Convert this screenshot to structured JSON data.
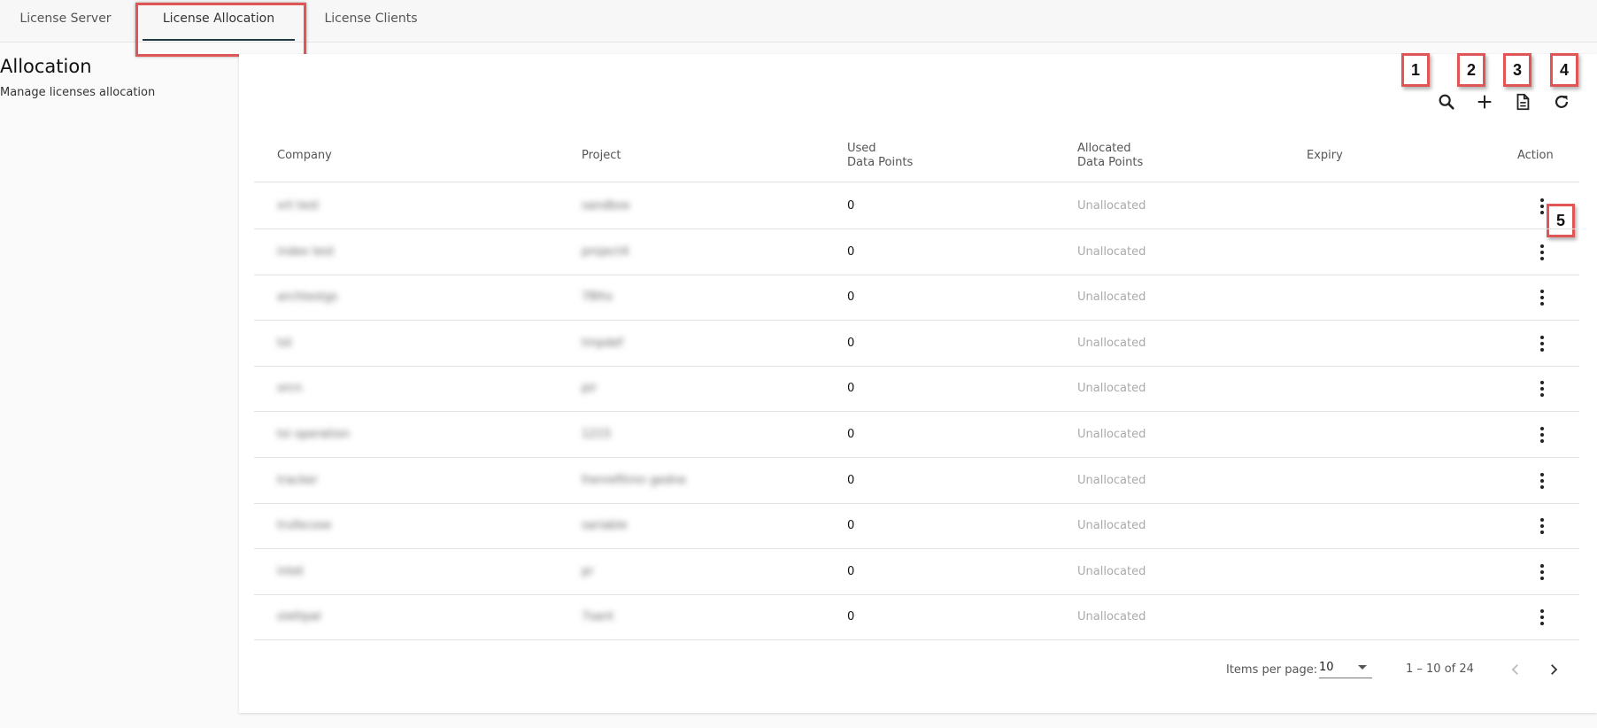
{
  "tabs": [
    {
      "label": "License Server",
      "active": false
    },
    {
      "label": "License Allocation",
      "active": true
    },
    {
      "label": "License Clients",
      "active": false
    }
  ],
  "sidebar": {
    "title": "Allocation",
    "subtitle": "Manage licenses allocation"
  },
  "markers": [
    "1",
    "2",
    "3",
    "4",
    "5"
  ],
  "toolbar": {
    "icons": [
      "search-icon",
      "add-icon",
      "document-icon",
      "refresh-icon"
    ]
  },
  "table": {
    "columns": {
      "company": "Company",
      "project": "Project",
      "used_1": "Used",
      "used_2": "Data Points",
      "allocated_1": "Allocated",
      "allocated_2": "Data Points",
      "expiry": "Expiry",
      "action": "Action"
    },
    "rows": [
      {
        "company": "xrt test",
        "project": "sandbox",
        "used": "0",
        "allocated": "Unallocated",
        "expiry": ""
      },
      {
        "company": "index test",
        "project": "project4",
        "used": "0",
        "allocated": "Unallocated",
        "expiry": ""
      },
      {
        "company": "archtestgs",
        "project": "78lhs",
        "used": "0",
        "allocated": "Unallocated",
        "expiry": ""
      },
      {
        "company": "tst",
        "project": "tmpdef",
        "used": "0",
        "allocated": "Unallocated",
        "expiry": ""
      },
      {
        "company": "orcn",
        "project": "pir",
        "used": "0",
        "allocated": "Unallocated",
        "expiry": ""
      },
      {
        "company": "tsi operation",
        "project": "1215",
        "used": "0",
        "allocated": "Unallocated",
        "expiry": ""
      },
      {
        "company": "tracker",
        "project": "frenrefitmn gedne",
        "used": "0",
        "allocated": "Unallocated",
        "expiry": ""
      },
      {
        "company": "trufecose",
        "project": "sariable",
        "used": "0",
        "allocated": "Unallocated",
        "expiry": ""
      },
      {
        "company": "intet",
        "project": "pr",
        "used": "0",
        "allocated": "Unallocated",
        "expiry": ""
      },
      {
        "company": "oiettpal",
        "project": "7sant",
        "used": "0",
        "allocated": "Unallocated",
        "expiry": ""
      }
    ]
  },
  "pagination": {
    "items_per_page_label": "Items per page:",
    "items_per_page_value": "10",
    "range": "1 – 10 of 24"
  },
  "colors": {
    "highlight": "#e05555",
    "tab_underline": "#1f3b40"
  }
}
